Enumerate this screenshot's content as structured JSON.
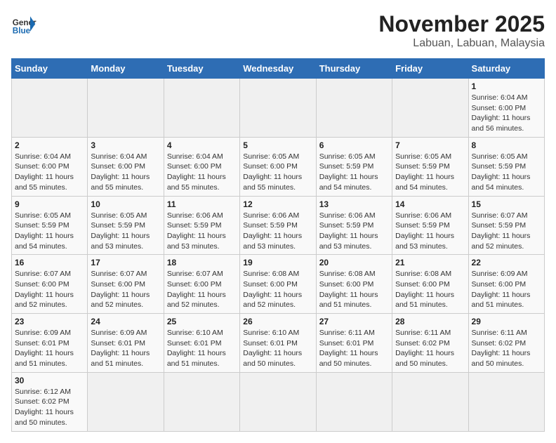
{
  "header": {
    "logo_general": "General",
    "logo_blue": "Blue",
    "month_title": "November 2025",
    "location": "Labuan, Labuan, Malaysia"
  },
  "calendar": {
    "days_of_week": [
      "Sunday",
      "Monday",
      "Tuesday",
      "Wednesday",
      "Thursday",
      "Friday",
      "Saturday"
    ],
    "weeks": [
      [
        {
          "day": "",
          "info": ""
        },
        {
          "day": "",
          "info": ""
        },
        {
          "day": "",
          "info": ""
        },
        {
          "day": "",
          "info": ""
        },
        {
          "day": "",
          "info": ""
        },
        {
          "day": "",
          "info": ""
        },
        {
          "day": "1",
          "info": "Sunrise: 6:04 AM\nSunset: 6:00 PM\nDaylight: 11 hours\nand 56 minutes."
        }
      ],
      [
        {
          "day": "2",
          "info": "Sunrise: 6:04 AM\nSunset: 6:00 PM\nDaylight: 11 hours\nand 55 minutes."
        },
        {
          "day": "3",
          "info": "Sunrise: 6:04 AM\nSunset: 6:00 PM\nDaylight: 11 hours\nand 55 minutes."
        },
        {
          "day": "4",
          "info": "Sunrise: 6:04 AM\nSunset: 6:00 PM\nDaylight: 11 hours\nand 55 minutes."
        },
        {
          "day": "5",
          "info": "Sunrise: 6:05 AM\nSunset: 6:00 PM\nDaylight: 11 hours\nand 55 minutes."
        },
        {
          "day": "6",
          "info": "Sunrise: 6:05 AM\nSunset: 5:59 PM\nDaylight: 11 hours\nand 54 minutes."
        },
        {
          "day": "7",
          "info": "Sunrise: 6:05 AM\nSunset: 5:59 PM\nDaylight: 11 hours\nand 54 minutes."
        },
        {
          "day": "8",
          "info": "Sunrise: 6:05 AM\nSunset: 5:59 PM\nDaylight: 11 hours\nand 54 minutes."
        }
      ],
      [
        {
          "day": "9",
          "info": "Sunrise: 6:05 AM\nSunset: 5:59 PM\nDaylight: 11 hours\nand 54 minutes."
        },
        {
          "day": "10",
          "info": "Sunrise: 6:05 AM\nSunset: 5:59 PM\nDaylight: 11 hours\nand 53 minutes."
        },
        {
          "day": "11",
          "info": "Sunrise: 6:06 AM\nSunset: 5:59 PM\nDaylight: 11 hours\nand 53 minutes."
        },
        {
          "day": "12",
          "info": "Sunrise: 6:06 AM\nSunset: 5:59 PM\nDaylight: 11 hours\nand 53 minutes."
        },
        {
          "day": "13",
          "info": "Sunrise: 6:06 AM\nSunset: 5:59 PM\nDaylight: 11 hours\nand 53 minutes."
        },
        {
          "day": "14",
          "info": "Sunrise: 6:06 AM\nSunset: 5:59 PM\nDaylight: 11 hours\nand 53 minutes."
        },
        {
          "day": "15",
          "info": "Sunrise: 6:07 AM\nSunset: 5:59 PM\nDaylight: 11 hours\nand 52 minutes."
        }
      ],
      [
        {
          "day": "16",
          "info": "Sunrise: 6:07 AM\nSunset: 6:00 PM\nDaylight: 11 hours\nand 52 minutes."
        },
        {
          "day": "17",
          "info": "Sunrise: 6:07 AM\nSunset: 6:00 PM\nDaylight: 11 hours\nand 52 minutes."
        },
        {
          "day": "18",
          "info": "Sunrise: 6:07 AM\nSunset: 6:00 PM\nDaylight: 11 hours\nand 52 minutes."
        },
        {
          "day": "19",
          "info": "Sunrise: 6:08 AM\nSunset: 6:00 PM\nDaylight: 11 hours\nand 52 minutes."
        },
        {
          "day": "20",
          "info": "Sunrise: 6:08 AM\nSunset: 6:00 PM\nDaylight: 11 hours\nand 51 minutes."
        },
        {
          "day": "21",
          "info": "Sunrise: 6:08 AM\nSunset: 6:00 PM\nDaylight: 11 hours\nand 51 minutes."
        },
        {
          "day": "22",
          "info": "Sunrise: 6:09 AM\nSunset: 6:00 PM\nDaylight: 11 hours\nand 51 minutes."
        }
      ],
      [
        {
          "day": "23",
          "info": "Sunrise: 6:09 AM\nSunset: 6:01 PM\nDaylight: 11 hours\nand 51 minutes."
        },
        {
          "day": "24",
          "info": "Sunrise: 6:09 AM\nSunset: 6:01 PM\nDaylight: 11 hours\nand 51 minutes."
        },
        {
          "day": "25",
          "info": "Sunrise: 6:10 AM\nSunset: 6:01 PM\nDaylight: 11 hours\nand 51 minutes."
        },
        {
          "day": "26",
          "info": "Sunrise: 6:10 AM\nSunset: 6:01 PM\nDaylight: 11 hours\nand 50 minutes."
        },
        {
          "day": "27",
          "info": "Sunrise: 6:11 AM\nSunset: 6:01 PM\nDaylight: 11 hours\nand 50 minutes."
        },
        {
          "day": "28",
          "info": "Sunrise: 6:11 AM\nSunset: 6:02 PM\nDaylight: 11 hours\nand 50 minutes."
        },
        {
          "day": "29",
          "info": "Sunrise: 6:11 AM\nSunset: 6:02 PM\nDaylight: 11 hours\nand 50 minutes."
        }
      ],
      [
        {
          "day": "30",
          "info": "Sunrise: 6:12 AM\nSunset: 6:02 PM\nDaylight: 11 hours\nand 50 minutes."
        },
        {
          "day": "",
          "info": ""
        },
        {
          "day": "",
          "info": ""
        },
        {
          "day": "",
          "info": ""
        },
        {
          "day": "",
          "info": ""
        },
        {
          "day": "",
          "info": ""
        },
        {
          "day": "",
          "info": ""
        }
      ]
    ]
  }
}
